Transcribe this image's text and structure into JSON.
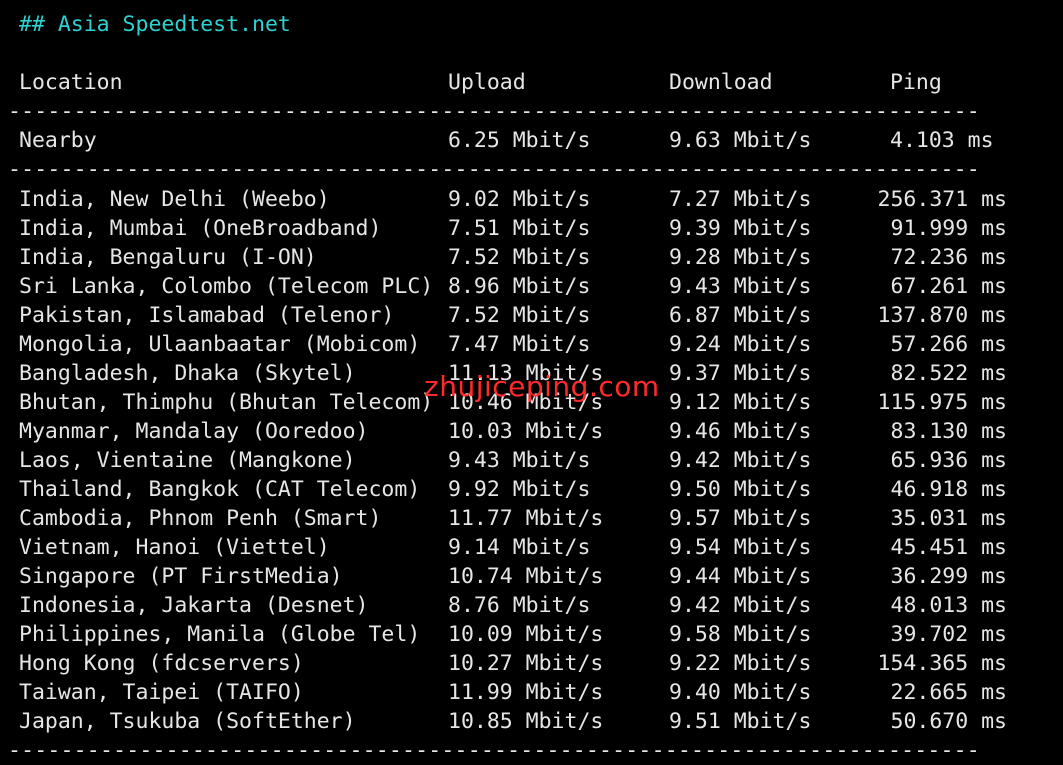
{
  "title": "## Asia Speedtest.net",
  "headers": {
    "location": "Location",
    "upload": "Upload",
    "download": "Download",
    "ping": "Ping"
  },
  "separator": "-----------------------------------------------------------------------------",
  "nearby": {
    "location": "Nearby",
    "upload": "6.25 Mbit/s",
    "download": "9.63 Mbit/s",
    "ping": "4.103 ms"
  },
  "rows": [
    {
      "location": "India, New Delhi (Weebo)",
      "upload": "9.02 Mbit/s",
      "download": "7.27 Mbit/s",
      "ping": "256.371 ms"
    },
    {
      "location": "India, Mumbai (OneBroadband)",
      "upload": "7.51 Mbit/s",
      "download": "9.39 Mbit/s",
      "ping": "91.999 ms"
    },
    {
      "location": "India, Bengaluru (I-ON)",
      "upload": "7.52 Mbit/s",
      "download": "9.28 Mbit/s",
      "ping": "72.236 ms"
    },
    {
      "location": "Sri Lanka, Colombo (Telecom PLC)",
      "upload": "8.96 Mbit/s",
      "download": "9.43 Mbit/s",
      "ping": "67.261 ms"
    },
    {
      "location": "Pakistan, Islamabad (Telenor)",
      "upload": "7.52 Mbit/s",
      "download": "6.87 Mbit/s",
      "ping": "137.870 ms"
    },
    {
      "location": "Mongolia, Ulaanbaatar (Mobicom)",
      "upload": "7.47 Mbit/s",
      "download": "9.24 Mbit/s",
      "ping": "57.266 ms"
    },
    {
      "location": "Bangladesh, Dhaka (Skytel)",
      "upload": "11.13 Mbit/s",
      "download": "9.37 Mbit/s",
      "ping": "82.522 ms"
    },
    {
      "location": "Bhutan, Thimphu (Bhutan Telecom)",
      "upload": "10.46 Mbit/s",
      "download": "9.12 Mbit/s",
      "ping": "115.975 ms"
    },
    {
      "location": "Myanmar, Mandalay (Ooredoo)",
      "upload": "10.03 Mbit/s",
      "download": "9.46 Mbit/s",
      "ping": "83.130 ms"
    },
    {
      "location": "Laos, Vientaine (Mangkone)",
      "upload": "9.43 Mbit/s",
      "download": "9.42 Mbit/s",
      "ping": "65.936 ms"
    },
    {
      "location": "Thailand, Bangkok (CAT Telecom)",
      "upload": "9.92 Mbit/s",
      "download": "9.50 Mbit/s",
      "ping": "46.918 ms"
    },
    {
      "location": "Cambodia, Phnom Penh (Smart)",
      "upload": "11.77 Mbit/s",
      "download": "9.57 Mbit/s",
      "ping": "35.031 ms"
    },
    {
      "location": "Vietnam, Hanoi (Viettel)",
      "upload": "9.14 Mbit/s",
      "download": "9.54 Mbit/s",
      "ping": "45.451 ms"
    },
    {
      "location": "Singapore (PT FirstMedia)",
      "upload": "10.74 Mbit/s",
      "download": "9.44 Mbit/s",
      "ping": "36.299 ms"
    },
    {
      "location": "Indonesia, Jakarta (Desnet)",
      "upload": "8.76 Mbit/s",
      "download": "9.42 Mbit/s",
      "ping": "48.013 ms"
    },
    {
      "location": "Philippines, Manila (Globe Tel)",
      "upload": "10.09 Mbit/s",
      "download": "9.58 Mbit/s",
      "ping": "39.702 ms"
    },
    {
      "location": "Hong Kong (fdcservers)",
      "upload": "10.27 Mbit/s",
      "download": "9.22 Mbit/s",
      "ping": "154.365 ms"
    },
    {
      "location": "Taiwan, Taipei (TAIFO)",
      "upload": "11.99 Mbit/s",
      "download": "9.40 Mbit/s",
      "ping": "22.665 ms"
    },
    {
      "location": "Japan, Tsukuba (SoftEther)",
      "upload": "10.85 Mbit/s",
      "download": "9.51 Mbit/s",
      "ping": "50.670 ms"
    }
  ],
  "watermark": "zhujiceping.com",
  "colors": {
    "background": "#000000",
    "text": "#e6e6e6",
    "title": "#2ed1d1",
    "watermark": "#ff2a2a"
  }
}
